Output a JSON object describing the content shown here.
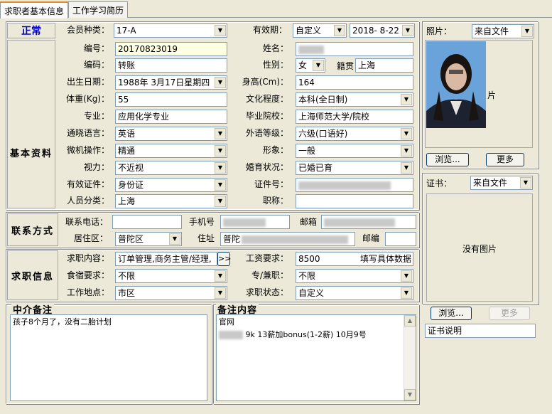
{
  "tabs": [
    {
      "label": "求职者基本信息"
    },
    {
      "label": "工作学习简历"
    }
  ],
  "status": {
    "label": "正常"
  },
  "top": {
    "member_type_label": "会员种类：",
    "member_type": "17-A",
    "validity_label": "有效期：",
    "validity_mode": "自定义",
    "validity_date": "2018- 8-22"
  },
  "basic": {
    "section_title": "基本资料",
    "number_label": "编号：",
    "number": "20170823019",
    "code_label": "编码：",
    "code": "转账",
    "birth_label": "出生日期：",
    "birth": "1988年 3月17日星期四",
    "weight_label": "体重(Kg)：",
    "weight": "55",
    "major_label": "专业：",
    "major": "应用化学专业",
    "common_lang_label": "通晓语言：",
    "common_lang": "英语",
    "computer_label": "微机操作：",
    "computer": "精通",
    "vision_label": "视力：",
    "vision": "不近视",
    "id_doc_label": "有效证件：",
    "id_doc": "身份证",
    "person_class_label": "人员分类：",
    "person_class": "上海",
    "name_label": "姓名：",
    "gender_label": "性别：",
    "gender": "女",
    "native_label": "籍贯",
    "native": "上海",
    "height_label": "身高(Cm)：",
    "height": "164",
    "education_label": "文化程度：",
    "education": "本科(全日制)",
    "school_label": "毕业院校：",
    "school": "上海师范大学/院校",
    "foreign_label": "外语等级：",
    "foreign": "六级(口语好)",
    "image_label": "形象：",
    "image": "一般",
    "marital_label": "婚育状况：",
    "marital": "已婚已育",
    "cert_no_label": "证件号：",
    "title_label": "职称："
  },
  "contact": {
    "section_title": "联系方式",
    "phone_label": "联系电话：",
    "mobile_label": "手机号",
    "email_label": "邮箱",
    "district_label": "居住区：",
    "district": "普陀区",
    "address_label": "住址",
    "address": "普陀",
    "zip_label": "邮编"
  },
  "job": {
    "section_title": "求职信息",
    "content_label": "求职内容：",
    "content": "订单管理,商务主管/经理,",
    "more_btn": ">>",
    "salary_label": "工资要求：",
    "salary": "8500",
    "salary_hint": "填写具体数据",
    "board_label": "食宿要求：",
    "board": "不限",
    "parttime_label": "专/兼职：",
    "parttime": "不限",
    "location_label": "工作地点：",
    "location": "市区",
    "state_label": "求职状态：",
    "state": "自定义"
  },
  "agent_note": {
    "title": "中介备注",
    "text": "孩子8个月了，没有二胎计划"
  },
  "remark": {
    "title": "备注内容",
    "line1": "官网",
    "line2": "9k 13薪加bonus(1-2薪) 10月9号"
  },
  "photo": {
    "label": "照片：",
    "source": "来自文件",
    "stamp": "片",
    "browse": "浏览...",
    "more": "更多"
  },
  "cert": {
    "label": "证书：",
    "source": "来自文件",
    "empty_text": "没有图片",
    "browse": "浏览...",
    "more": "更多",
    "desc": "证书说明"
  }
}
